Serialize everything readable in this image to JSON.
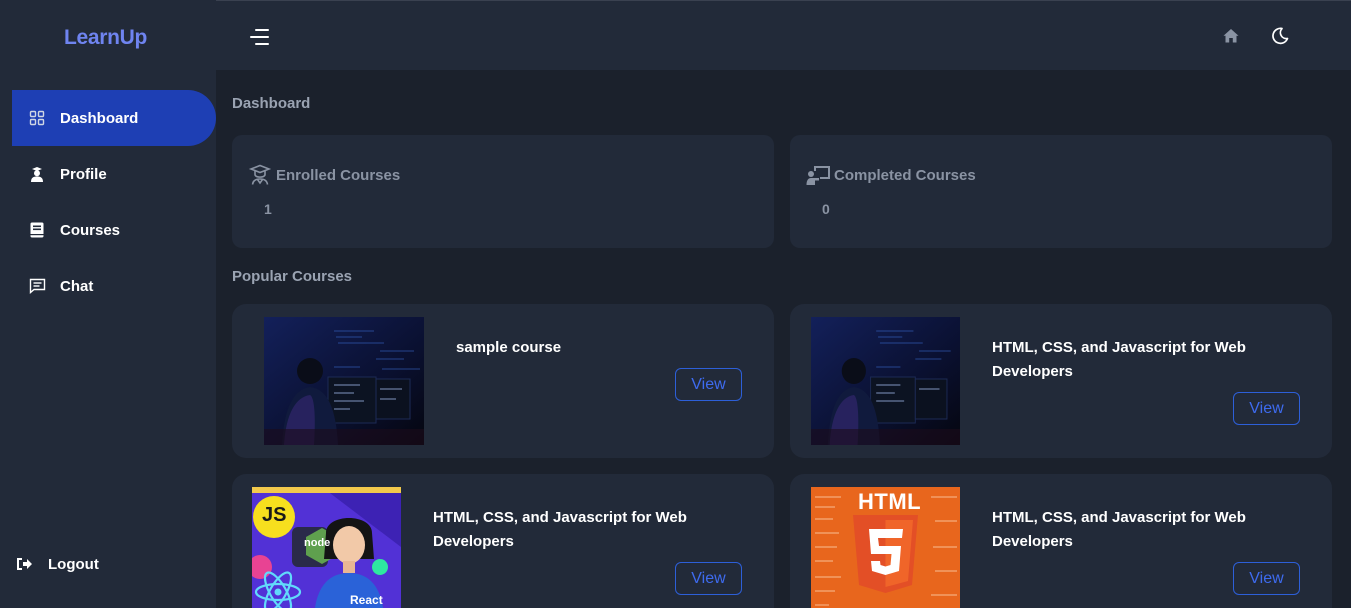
{
  "app": {
    "logo": "LearnUp"
  },
  "sidebar": {
    "items": [
      {
        "label": "Dashboard",
        "icon": "grid-icon",
        "active": true
      },
      {
        "label": "Profile",
        "icon": "user-icon",
        "active": false
      },
      {
        "label": "Courses",
        "icon": "book-icon",
        "active": false
      },
      {
        "label": "Chat",
        "icon": "chat-icon",
        "active": false
      }
    ],
    "logout": "Logout"
  },
  "topbar": {
    "icons": [
      "menu-icon",
      "home-icon",
      "moon-icon"
    ]
  },
  "main": {
    "title": "Dashboard",
    "stats": [
      {
        "label": "Enrolled Courses",
        "value": "1",
        "icon": "graduate-icon"
      },
      {
        "label": "Completed Courses",
        "value": "0",
        "icon": "teacher-board-icon"
      }
    ],
    "popular_title": "Popular Courses",
    "courses": [
      {
        "title": "sample course",
        "button": "View"
      },
      {
        "title": "HTML, CSS, and Javascript for Web Developers",
        "button": "View"
      },
      {
        "title": "HTML, CSS, and Javascript for Web Developers",
        "button": "View"
      },
      {
        "title": "HTML, CSS, and Javascript for Web Developers",
        "button": "View"
      }
    ],
    "thumb_text": {
      "js": "JS",
      "node": "node",
      "react": "React",
      "html": "HTML",
      "five": "5"
    }
  },
  "colors": {
    "accent": "#1e3fb4",
    "logo": "#6f84f0",
    "button_border": "#2d5fd8",
    "sidebar_bg": "#222a39",
    "page_bg": "#1b212c"
  }
}
